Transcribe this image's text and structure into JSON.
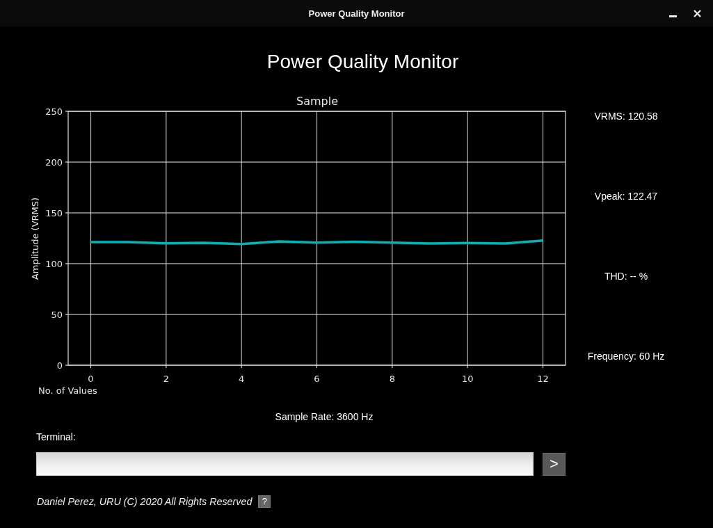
{
  "window": {
    "title": "Power Quality Monitor"
  },
  "heading": "Power Quality Monitor",
  "chart": {
    "chart_data": {
      "type": "line",
      "title": "Sample",
      "xlabel": "No. of Values",
      "ylabel": "Amplitude (VRMS)",
      "x": [
        0,
        1,
        2,
        3,
        4,
        5,
        6,
        7,
        8,
        9,
        10,
        11,
        12
      ],
      "series": [
        {
          "color": "#00b5b5",
          "values": [
            121.2,
            121.2,
            120.1,
            120.5,
            119.4,
            121.9,
            120.7,
            121.6,
            120.7,
            119.9,
            120.3,
            119.9,
            122.8
          ]
        }
      ],
      "xlim": [
        -0.6,
        12.6
      ],
      "ylim": [
        0,
        250
      ],
      "xticks": [
        0,
        2,
        4,
        6,
        8,
        10,
        12
      ],
      "yticks": [
        0,
        50,
        100,
        150,
        200,
        250
      ],
      "grid": true
    }
  },
  "readings": [
    "VRMS: 120.58",
    "Vpeak: 122.47",
    "THD: -- %",
    "Frequency: 60 Hz"
  ],
  "sample_rate": "Sample Rate: 3600 Hz",
  "terminal": {
    "label": "Terminal:",
    "send_button": ">"
  },
  "footer": {
    "text": "Daniel Perez, URU (C) 2020 All Rights Reserved",
    "help_button": "?"
  }
}
